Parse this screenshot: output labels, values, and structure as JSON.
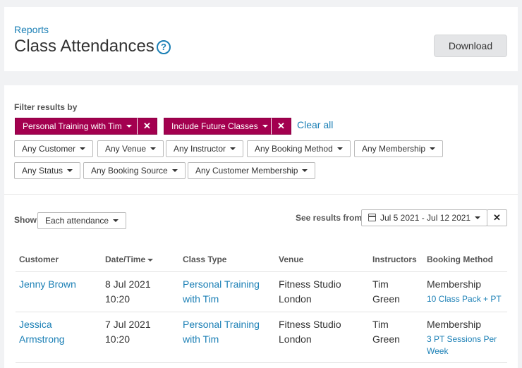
{
  "header": {
    "breadcrumb": "Reports",
    "title": "Class Attendances",
    "help_icon": "?",
    "download_label": "Download"
  },
  "filters": {
    "label": "Filter results by",
    "active_chips": [
      {
        "label": "Personal Training with Tim",
        "remove": "✕"
      },
      {
        "label": "Include Future Classes",
        "remove": "✕"
      }
    ],
    "clear_all": "Clear all",
    "dropdowns": [
      "Any Customer",
      "Any Venue",
      "Any Instructor",
      "Any Booking Method",
      "Any Membership",
      "Any Status",
      "Any Booking Source",
      "Any Customer Membership"
    ]
  },
  "controls": {
    "show_label": "Show",
    "show_value": "Each attendance",
    "see_results_label": "See results from",
    "date_range": "Jul 5 2021 - Jul 12 2021",
    "date_clear": "✕"
  },
  "table": {
    "columns": [
      "Customer",
      "Date/Time",
      "Class Type",
      "Venue",
      "Instructors",
      "Booking Method"
    ],
    "rows": [
      {
        "customer": [
          "Jenny Brown"
        ],
        "datetime": [
          "8 Jul 2021",
          "10:20"
        ],
        "class_type": [
          "Personal Training",
          "with Tim"
        ],
        "venue": [
          "Fitness Studio",
          "London"
        ],
        "instructors": [
          "Tim",
          "Green"
        ],
        "booking_method": "Membership",
        "membership": [
          "10 Class Pack + PT"
        ]
      },
      {
        "customer": [
          "Jessica",
          "Armstrong"
        ],
        "datetime": [
          "7 Jul 2021",
          "10:20"
        ],
        "class_type": [
          "Personal Training",
          "with Tim"
        ],
        "venue": [
          "Fitness Studio",
          "London"
        ],
        "instructors": [
          "Tim",
          "Green"
        ],
        "booking_method": "Membership",
        "membership": [
          "3 PT Sessions Per",
          "Week"
        ]
      }
    ]
  },
  "colors": {
    "accent": "#1a7fb5",
    "chip": "#a3004f",
    "background": "#f1f2f4"
  }
}
